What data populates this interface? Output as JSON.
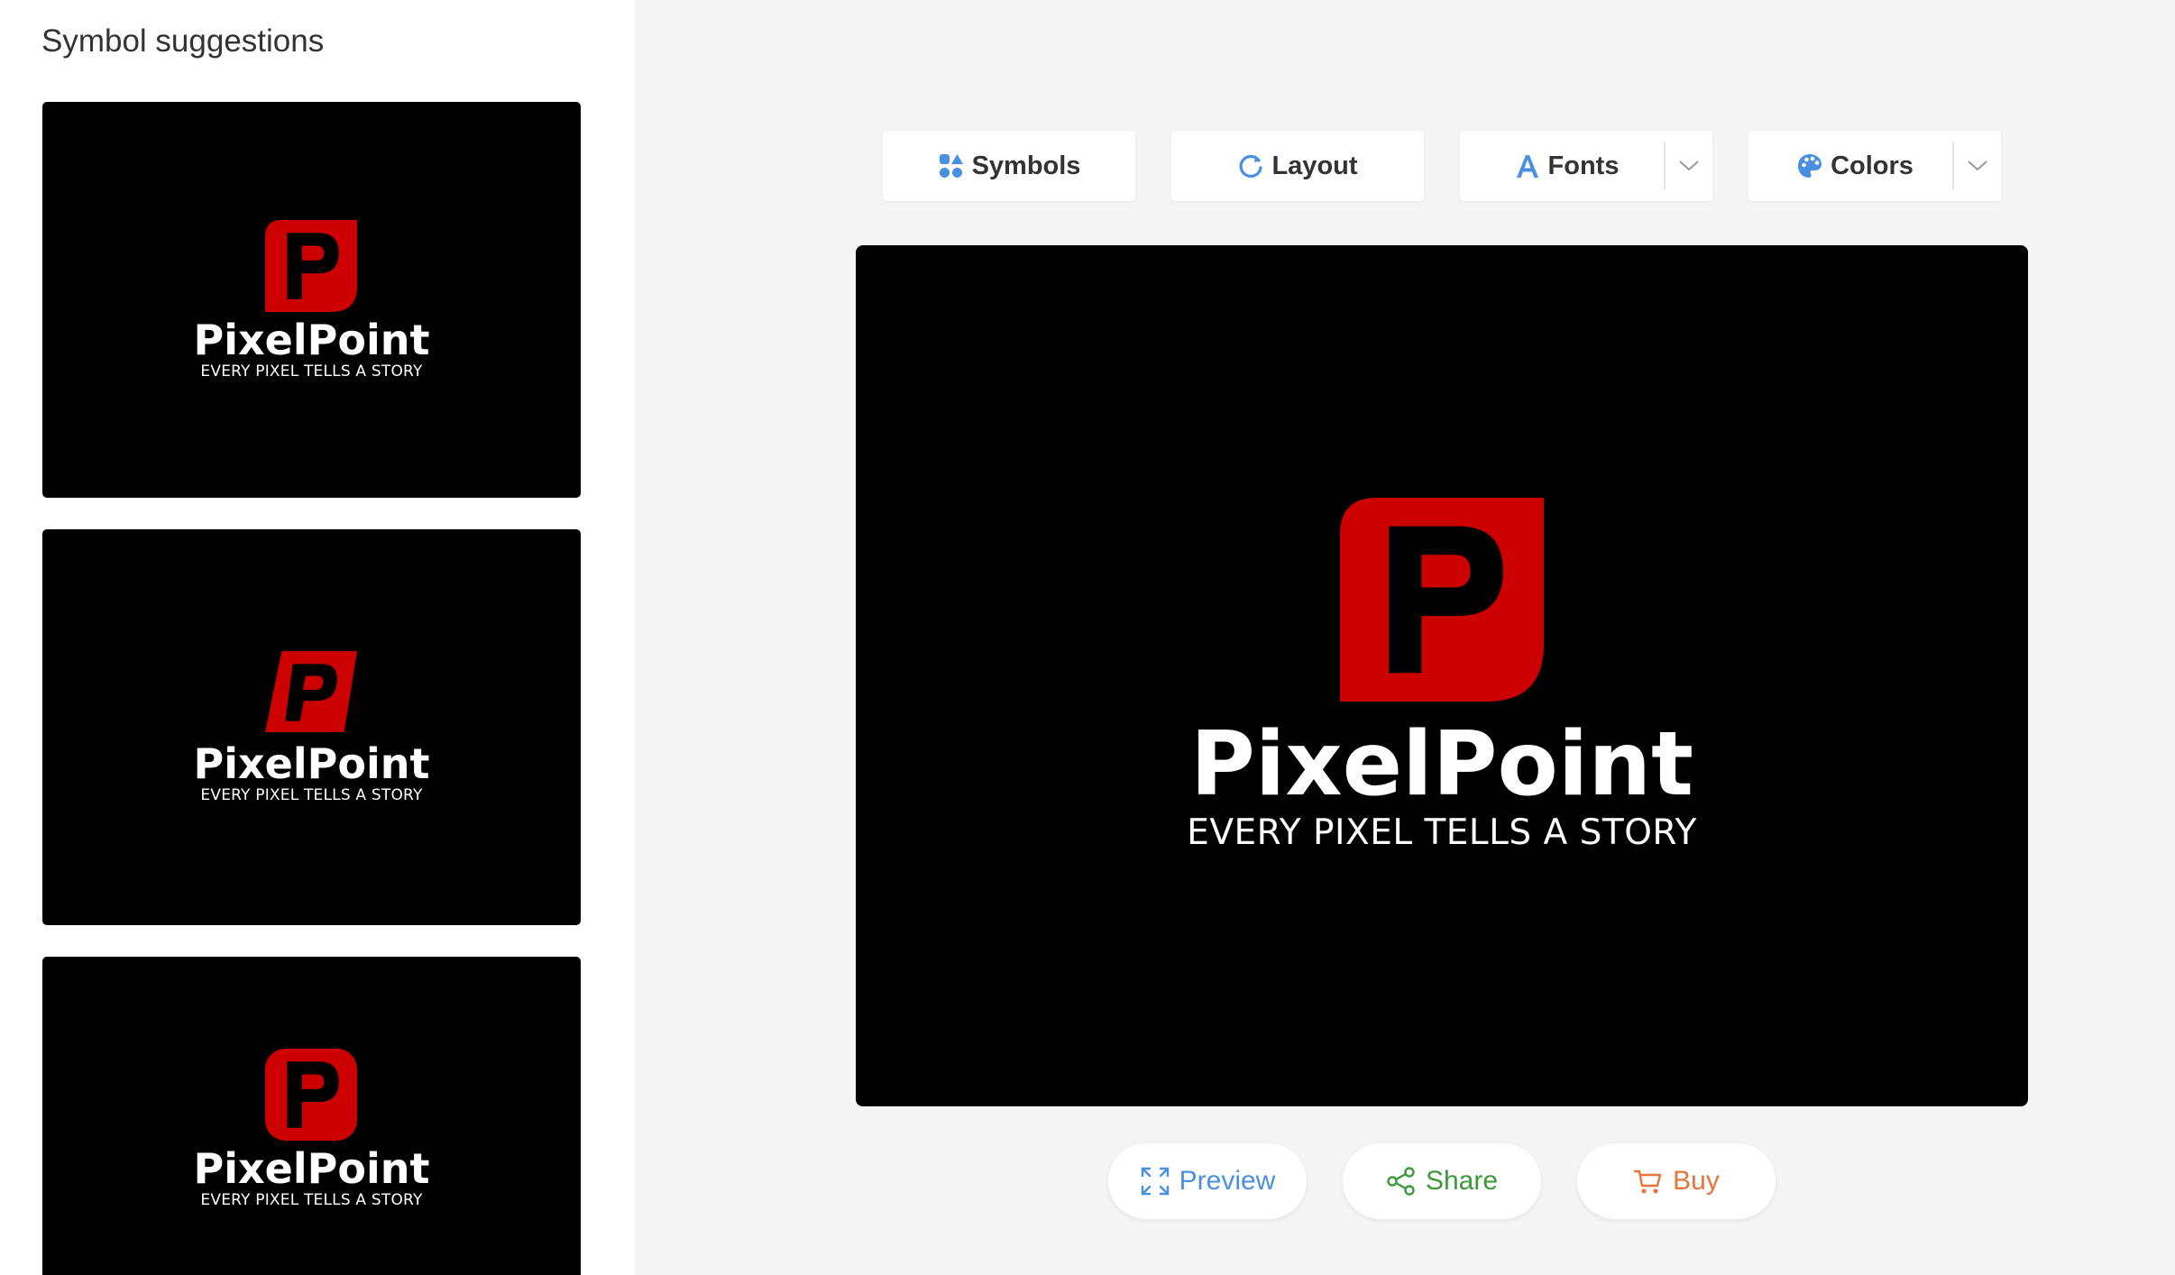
{
  "sidebar": {
    "title": "Symbol suggestions",
    "suggestions": [
      {
        "brand": "PixelPoint",
        "tagline": "EVERY PIXEL TELLS A STORY",
        "symbol": "p-leaf-icon"
      },
      {
        "brand": "PixelPoint",
        "tagline": "EVERY PIXEL TELLS A STORY",
        "symbol": "p-slanted-icon"
      },
      {
        "brand": "PixelPoint",
        "tagline": "EVERY PIXEL TELLS A STORY",
        "symbol": "p-rounded-icon"
      }
    ]
  },
  "toolbar": {
    "symbols_label": "Symbols",
    "layout_label": "Layout",
    "fonts_label": "Fonts",
    "colors_label": "Colors"
  },
  "canvas": {
    "brand": "PixelPoint",
    "tagline": "EVERY PIXEL TELLS A STORY",
    "symbol": "p-leaf-icon"
  },
  "actions": {
    "preview_label": "Preview",
    "share_label": "Share",
    "buy_label": "Buy"
  },
  "colors": {
    "logo_red": "#cc0000",
    "canvas_bg": "#000000",
    "page_bg": "#f5f5f5",
    "accent_blue": "#4a90e2",
    "share_green": "#3a9a3a",
    "buy_orange": "#e8743b"
  }
}
